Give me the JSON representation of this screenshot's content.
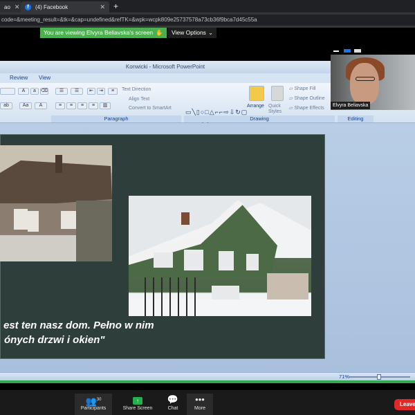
{
  "browser": {
    "tabs": [
      {
        "label": "ao"
      },
      {
        "label": "(4) Facebook"
      }
    ],
    "url": "code=&meeting_result=&tk=&cap=undefined&refTK=&wpk=wcpk809e25737578a73cb36f9bca7d45c55a"
  },
  "zoom_banner": {
    "viewing": "You are viewing Elvyra Beliavska's screen",
    "view_options": "View Options"
  },
  "powerpoint": {
    "title": "Konwicki - Microsoft PowerPoint",
    "tabs": [
      "Review",
      "View"
    ],
    "ribbon": {
      "text_direction": "Text Direction",
      "align_text": "Align Text",
      "convert_smartart": "Convert to SmartArt",
      "arrange": "Arrange",
      "quick_styles": "Quick Styles",
      "shape_fill": "Shape Fill",
      "shape_outline": "Shape Outline",
      "shape_effects": "Shape Effects",
      "groups": [
        "Paragraph",
        "Drawing",
        "Editing"
      ]
    },
    "slide_caption": [
      "est ten nasz dom. Pełno w nim",
      "ónych drzwi i okien\""
    ],
    "zoom": "71%"
  },
  "video": {
    "name": "Elvyra Beliavska"
  },
  "toolbar": {
    "participants_label": "Participants",
    "participants_count": "30",
    "share_label": "Share Screen",
    "chat_label": "Chat",
    "more_label": "More",
    "leave_label": "Leave"
  },
  "colors": {
    "banner_green": "#4caf50",
    "leave_red": "#e02828",
    "slide_bg": "#2e3e3b"
  }
}
